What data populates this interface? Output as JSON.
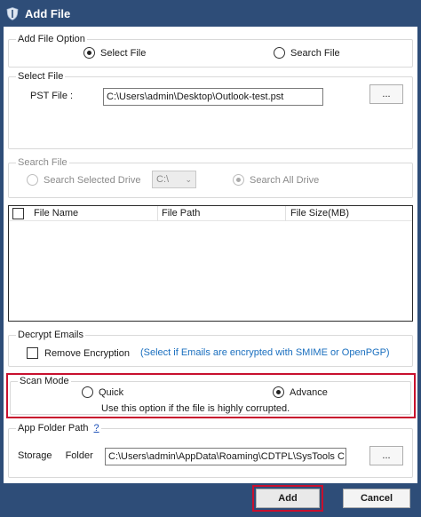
{
  "window": {
    "title": "Add File",
    "app_icon": "systools-shield-icon"
  },
  "add_file_option": {
    "group_label": "Add File Option",
    "select_file_label": "Select File",
    "search_file_label": "Search File",
    "selected": "select_file"
  },
  "select_file": {
    "group_label": "Select File",
    "pst_label": "PST File :",
    "pst_path": "C:\\Users\\admin\\Desktop\\Outlook-test.pst",
    "browse_label": "..."
  },
  "search_file": {
    "group_label": "Search File",
    "search_selected_drive_label": "Search Selected Drive",
    "drive_value": "C:\\",
    "search_all_drive_label": "Search All Drive",
    "selected": "search_all_drive",
    "enabled": false
  },
  "file_list": {
    "columns": [
      "File Name",
      "File Path",
      "File Size(MB)"
    ],
    "rows": []
  },
  "decrypt": {
    "group_label": "Decrypt Emails",
    "remove_encryption_label": "Remove Encryption",
    "remove_encryption_checked": false,
    "hint": "(Select if Emails are encrypted with SMIME or OpenPGP)"
  },
  "scan_mode": {
    "group_label": "Scan Mode",
    "quick_label": "Quick",
    "advance_label": "Advance",
    "selected": "advance",
    "note": "Use this option if the file is highly corrupted."
  },
  "app_folder": {
    "group_label": "App Folder Path",
    "help_label": "?",
    "storage_label": "Storage Folder :",
    "storage_path": "C:\\Users\\admin\\AppData\\Roaming\\CDTPL\\SysTools C",
    "browse_label": "..."
  },
  "actions": {
    "add_label": "Add",
    "cancel_label": "Cancel"
  },
  "colors": {
    "titlebar": "#2e4d78",
    "highlight_red": "#c8102e",
    "hint_blue": "#1a6fbf"
  }
}
